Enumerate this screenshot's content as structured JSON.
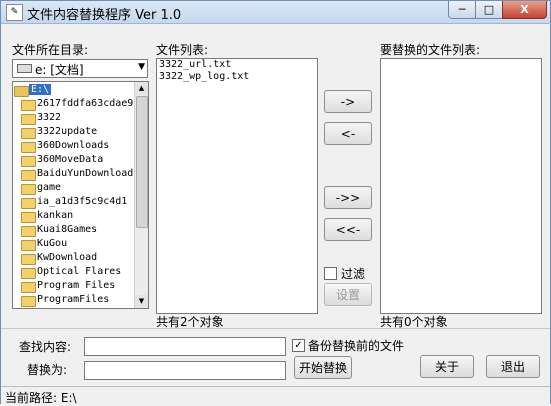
{
  "window": {
    "title": "文件内容替换程序 Ver 1.0",
    "icon_label": "✎",
    "minimize": "─",
    "maximize": "□",
    "close": "X"
  },
  "left": {
    "label": "文件所在目录:",
    "drive": "e: [文档]",
    "tree": [
      "E:\\",
      "2617fddfa63cdae9",
      "3322",
      "3322update",
      "360Downloads",
      "360MoveData",
      "BaiduYunDownload",
      "game",
      "ia_a1d3f5c9c4d1",
      "kankan",
      "Kuai8Games",
      "KuGou",
      "KwDownload",
      "Optical Flares",
      "Program Files",
      "ProgramFiles"
    ]
  },
  "middle": {
    "label": "文件列表:",
    "files": [
      "3322_url.txt",
      "3322_wp_log.txt"
    ],
    "count": "共有2个对象"
  },
  "buttons": {
    "add": "->",
    "remove": "<-",
    "add_all": "->>",
    "remove_all": "<<-",
    "filter": "过滤",
    "settings": "设置"
  },
  "right": {
    "label": "要替换的文件列表:",
    "count": "共有0个对象"
  },
  "form": {
    "find_label": "查找内容:",
    "replace_label": "替换为:",
    "backup_label": "备份替换前的文件",
    "start": "开始替换",
    "about": "关于",
    "exit": "退出"
  },
  "status": {
    "path": "当前路径: E:\\"
  }
}
